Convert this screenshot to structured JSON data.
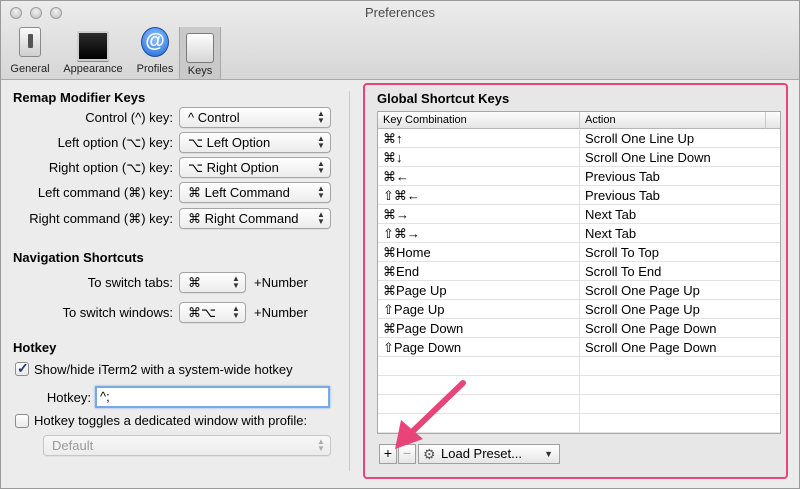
{
  "window": {
    "title": "Preferences"
  },
  "toolbar": {
    "tabs": [
      {
        "label": "General",
        "icon": "general-switch-icon"
      },
      {
        "label": "Appearance",
        "icon": "monitor-icon"
      },
      {
        "label": "Profiles",
        "icon": "at-sign-icon"
      },
      {
        "label": "Keys",
        "icon": "keyboard-icon"
      }
    ],
    "selected": "Keys"
  },
  "remap": {
    "heading": "Remap Modifier Keys",
    "rows": [
      {
        "label": "Control (^) key:",
        "value": "^ Control"
      },
      {
        "label": "Left option (⌥) key:",
        "value": "⌥ Left Option"
      },
      {
        "label": "Right option (⌥) key:",
        "value": "⌥ Right Option"
      },
      {
        "label": "Left command (⌘) key:",
        "value": "⌘ Left Command"
      },
      {
        "label": "Right command (⌘) key:",
        "value": "⌘ Right Command"
      }
    ]
  },
  "navigation": {
    "heading": "Navigation Shortcuts",
    "tabs_label": "To switch tabs:",
    "tabs_value": "⌘",
    "tabs_suffix": "+Number",
    "windows_label": "To switch windows:",
    "windows_value": "⌘⌥",
    "windows_suffix": "+Number"
  },
  "hotkey": {
    "heading": "Hotkey",
    "show_hide_label": "Show/hide iTerm2 with a system-wide hotkey",
    "show_hide_checked": true,
    "hotkey_label": "Hotkey:",
    "hotkey_value": "^;",
    "dedicated_label": "Hotkey toggles a dedicated window with profile:",
    "dedicated_checked": false,
    "profile_value": "Default"
  },
  "global": {
    "heading": "Global Shortcut Keys",
    "columns": [
      "Key Combination",
      "Action"
    ],
    "rows": [
      [
        "⌘↑",
        "Scroll One Line Up"
      ],
      [
        "⌘↓",
        "Scroll One Line Down"
      ],
      [
        "⌘←",
        "Previous Tab"
      ],
      [
        "⇧⌘←",
        "Previous Tab"
      ],
      [
        "⌘→",
        "Next Tab"
      ],
      [
        "⇧⌘→",
        "Next Tab"
      ],
      [
        "⌘Home",
        "Scroll To Top"
      ],
      [
        "⌘End",
        "Scroll To End"
      ],
      [
        "⌘Page Up",
        "Scroll One Page Up"
      ],
      [
        "⇧Page Up",
        "Scroll One Page Up"
      ],
      [
        "⌘Page Down",
        "Scroll One Page Down"
      ],
      [
        "⇧Page Down",
        "Scroll One Page Down"
      ],
      [
        "",
        ""
      ],
      [
        "",
        ""
      ],
      [
        "",
        ""
      ],
      [
        "",
        ""
      ]
    ],
    "add_label": "+",
    "remove_label": "−",
    "preset_label": "Load Preset...",
    "highlight_color": "#e8447a"
  }
}
